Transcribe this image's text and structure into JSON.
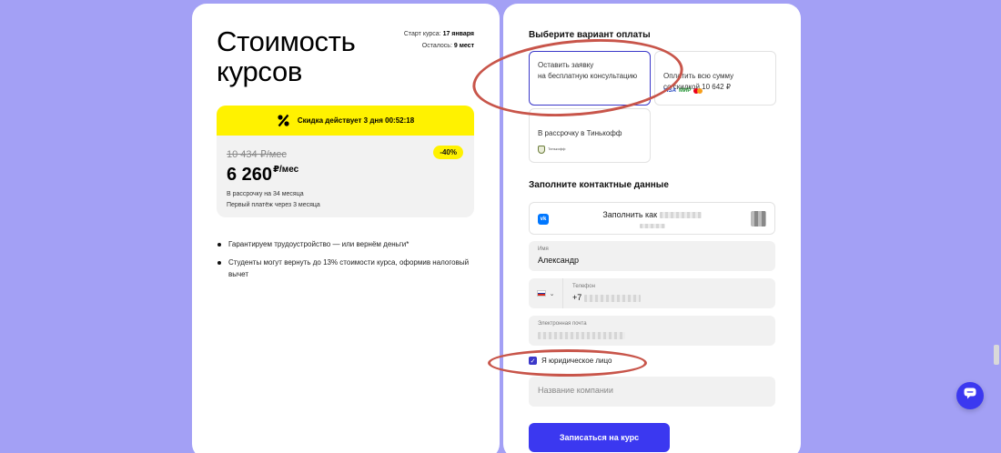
{
  "left": {
    "title": "Стоимость\nкурсов",
    "start_label": "Старт курса:",
    "start_value": "17 января",
    "remaining_label": "Осталось:",
    "remaining_value": "9 мест",
    "promo": "Скидка действует 3 дня 00:52:18",
    "old_price": "10 434 ₽/мес",
    "discount": "-40%",
    "new_price": "6 260",
    "new_price_unit": "₽/мес",
    "installment_line1": "В рассрочку на 34 месяца",
    "installment_line2": "Первый платёж через 3 месяца",
    "bullets": [
      "Гарантируем трудоустройство — или вернём деньги*",
      "Студенты могут вернуть до 13% стоимости курса, оформив налоговый вычет"
    ]
  },
  "right": {
    "payment_title": "Выберите вариант оплаты",
    "options": [
      {
        "text": "Оставить заявку\nна бесплатную консультацию",
        "selected": true
      },
      {
        "text": "Оплатить всю сумму\nсо скидкой 10 642 ₽",
        "selected": false
      },
      {
        "text": "В рассрочку в Тинькофф",
        "selected": false
      }
    ],
    "card_logos": {
      "visa": "VISA",
      "mir": "МИР"
    },
    "tinkoff_caption": "Тинькофф",
    "contact_title": "Заполните контактные данные",
    "vk_label": "Заполнить как",
    "name_label": "Имя",
    "name_value": "Александр",
    "phone_label": "Телефон",
    "phone_prefix": "+7",
    "email_label": "Электронная почта",
    "legal_entity_label": "Я юридическое лицо",
    "legal_entity_checked": true,
    "company_placeholder": "Название компании",
    "submit_label": "Записаться на курс"
  },
  "colors": {
    "background": "#a3a0f5",
    "accent": "#3b38f0",
    "promo_yellow": "#fff200",
    "annotation_red": "#c8554a"
  },
  "icons": [
    "percent-icon",
    "vk-icon",
    "russia-flag-icon",
    "chevron-down-icon",
    "checkmark-icon",
    "chat-icon"
  ]
}
